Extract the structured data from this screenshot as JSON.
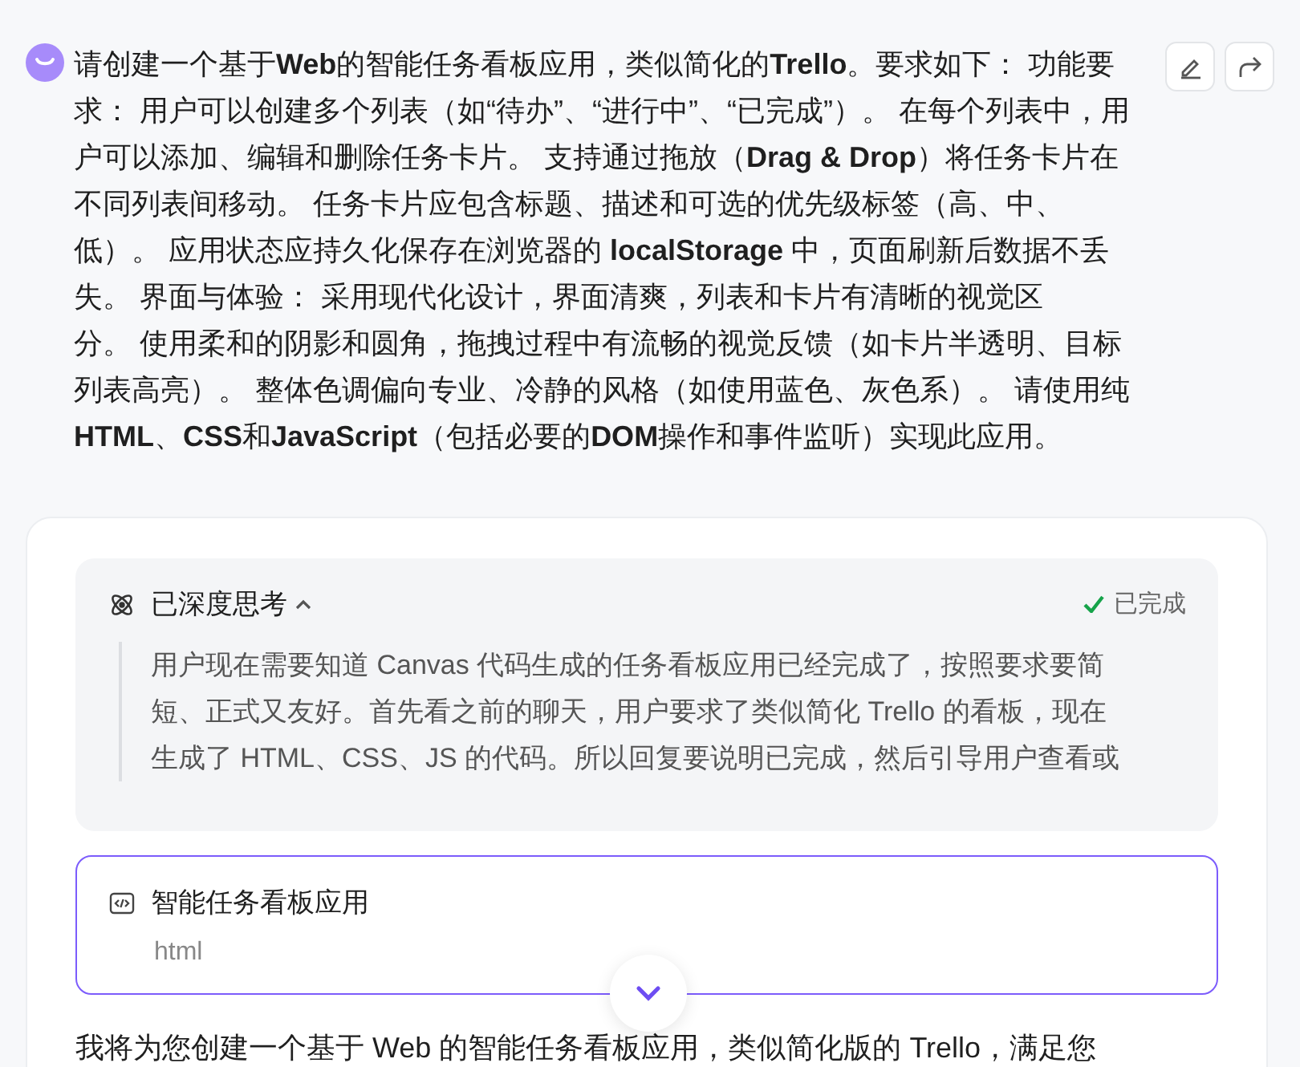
{
  "user_message": {
    "text": "请创建一个基于**Web**的智能任务看板应用，类似简化的**Trello**。要求如下： 功能要求： 用户可以创建多个列表（如“待办”、“进行中”、“已完成”）。 在每个列表中，用户可以添加、编辑和删除任务卡片。 支持通过拖放（**Drag & Drop**）将任务卡片在不同列表间移动。 任务卡片应包含标题、描述和可选的优先级标签（高、中、低）。 应用状态应持久化保存在浏览器的 **localStorage** 中，页面刷新后数据不丢失。 界面与体验： 采用现代化设计，界面清爽，列表和卡片有清晰的视觉区分。 使用柔和的阴影和圆角，拖拽过程中有流畅的视觉反馈（如卡片半透明、目标列表高亮）。 整体色调偏向专业、冷静的风格（如使用蓝色、灰色系）。 请使用纯**HTML**、**CSS**和**JavaScript**（包括必要的**DOM**操作和事件监听）实现此应用。"
  },
  "thinking": {
    "title": "已深度思考",
    "expanded": true,
    "status": "已完成",
    "lines": [
      "用户现在需要知道 Canvas 代码生成的任务看板应用已经完成了，按照要求要简",
      "短、正式又友好。首先看之前的聊天，用户要求了类似简化 Trello 的看板，现在",
      "生成了 HTML、CSS、JS 的代码。所以回复要说明已完成，然后引导用户查看或"
    ]
  },
  "artifact": {
    "title": "智能任务看板应用",
    "type": "html"
  },
  "reply": {
    "text": "我将为您创建一个基于 Web 的智能任务看板应用，类似简化版的 Trello，满足您"
  }
}
